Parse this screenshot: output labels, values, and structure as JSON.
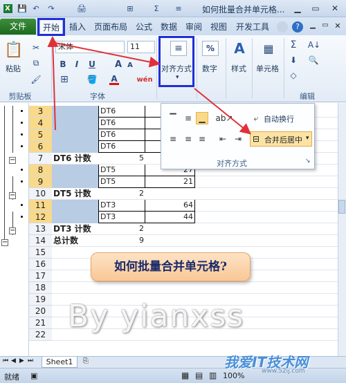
{
  "title": "如何批量合并单元格...",
  "qat": {
    "save": "💾",
    "undo": "↶",
    "redo": "↷",
    "print": "🖨",
    "format": "⊞",
    "sum": "Σ",
    "align": "≡"
  },
  "window": {
    "minimize": "?",
    "restore": "▭",
    "close": "✕"
  },
  "tabs": {
    "file": "文件",
    "home": "开始",
    "insert": "插入",
    "page_layout": "页面布局",
    "formulas": "公式",
    "data": "数据",
    "review": "审阅",
    "view": "视图",
    "developer": "开发工具"
  },
  "ribbon": {
    "paste": "粘贴",
    "clipboard": "剪贴板",
    "font_name": "宋体",
    "font_size": "11",
    "bold": "B",
    "italic": "I",
    "underline": "U",
    "grow": "A",
    "shrink": "A",
    "font_group": "字体",
    "alignment": "对齐方式",
    "number": "数字",
    "number_pct": "%",
    "styles": "样式",
    "cells": "单元格",
    "editing": "编辑",
    "font_color": "A",
    "wen": "wén"
  },
  "popup": {
    "wrap_text": "自动换行",
    "merge_center": "合并后居中",
    "group_label": "对齐方式"
  },
  "rows": [
    {
      "num": "3",
      "sel": true,
      "a": "",
      "b": "DT6",
      "c": "",
      "d": ""
    },
    {
      "num": "4",
      "sel": true,
      "a": "",
      "b": "DT6",
      "c": "",
      "d": ""
    },
    {
      "num": "5",
      "sel": true,
      "a": "",
      "b": "DT6",
      "c": "",
      "d": ""
    },
    {
      "num": "6",
      "sel": true,
      "a": "",
      "b": "DT6",
      "c": "",
      "d": ""
    },
    {
      "num": "7",
      "sel": false,
      "a": "DT6 计数",
      "b": "",
      "c": "5",
      "d": ""
    },
    {
      "num": "8",
      "sel": true,
      "a": "",
      "b": "DT5",
      "c": "",
      "d": "27"
    },
    {
      "num": "9",
      "sel": true,
      "a": "",
      "b": "DT5",
      "c": "",
      "d": "21"
    },
    {
      "num": "10",
      "sel": false,
      "a": "DT5 计数",
      "b": "",
      "c": "2",
      "d": ""
    },
    {
      "num": "11",
      "sel": true,
      "a": "",
      "b": "DT3",
      "c": "",
      "d": "64"
    },
    {
      "num": "12",
      "sel": true,
      "a": "",
      "b": "DT3",
      "c": "",
      "d": "44"
    },
    {
      "num": "13",
      "sel": false,
      "a": "DT3 计数",
      "b": "",
      "c": "2",
      "d": ""
    },
    {
      "num": "14",
      "sel": false,
      "a": "总计数",
      "b": "",
      "c": "9",
      "d": ""
    },
    {
      "num": "15",
      "sel": false,
      "a": "",
      "b": "",
      "c": "",
      "d": ""
    },
    {
      "num": "16",
      "sel": false,
      "a": "",
      "b": "",
      "c": "",
      "d": ""
    },
    {
      "num": "17",
      "sel": false,
      "a": "",
      "b": "",
      "c": "",
      "d": ""
    },
    {
      "num": "18",
      "sel": false,
      "a": "",
      "b": "",
      "c": "",
      "d": ""
    },
    {
      "num": "19",
      "sel": false,
      "a": "",
      "b": "",
      "c": "",
      "d": ""
    },
    {
      "num": "20",
      "sel": false,
      "a": "",
      "b": "",
      "c": "",
      "d": ""
    },
    {
      "num": "21",
      "sel": false,
      "a": "",
      "b": "",
      "c": "",
      "d": ""
    },
    {
      "num": "22",
      "sel": false,
      "a": "",
      "b": "",
      "c": "",
      "d": ""
    }
  ],
  "callout": "如何批量合并单元格?",
  "watermark": "By yianxss",
  "sheet_tab": "Sheet1",
  "status": {
    "ready": "就绪",
    "zoom": "100%"
  },
  "logo": "我爱IT技术网",
  "logo_sub": "www.52ij.com",
  "colors": {
    "file_tab": "#2a7a2a",
    "highlight": "#1f2fd6",
    "arrow": "#e0303a",
    "selected_cell": "#b8cce4",
    "row_selected": "#f9d98a"
  }
}
